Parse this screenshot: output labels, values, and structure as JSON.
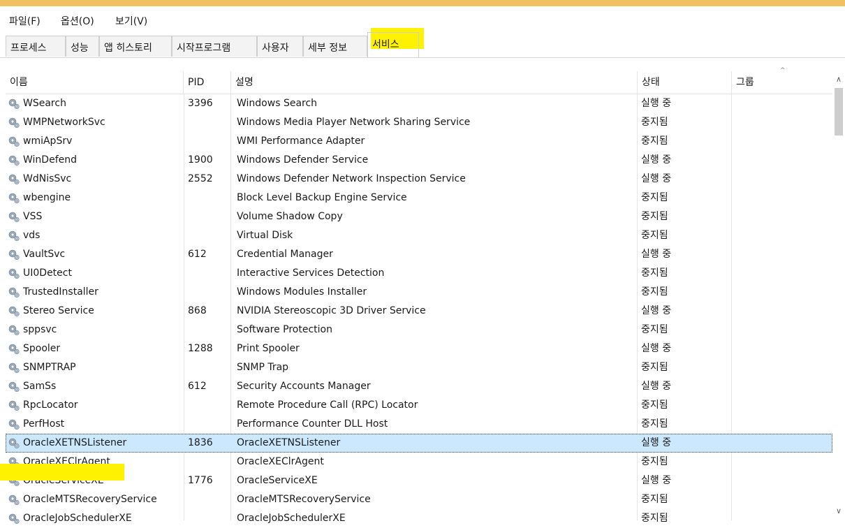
{
  "menu": [
    {
      "label": "파일(F)"
    },
    {
      "label": "옵션(O)"
    },
    {
      "label": "보기(V)"
    }
  ],
  "tabs": [
    {
      "label": "프로세스"
    },
    {
      "label": "성능"
    },
    {
      "label": "앱 히스토리"
    },
    {
      "label": "시작프로그램"
    },
    {
      "label": "사용자"
    },
    {
      "label": "세부 정보"
    },
    {
      "label": "서비스",
      "active": true
    }
  ],
  "columns": {
    "name": "이름",
    "pid": "PID",
    "desc": "설명",
    "status": "상태",
    "group": "그룹"
  },
  "sort_indicator": "^",
  "rows": [
    {
      "name": "WSearch",
      "pid": "3396",
      "desc": "Windows Search",
      "status": "실행 중"
    },
    {
      "name": "WMPNetworkSvc",
      "pid": "",
      "desc": "Windows Media Player Network Sharing Service",
      "status": "중지됨"
    },
    {
      "name": "wmiApSrv",
      "pid": "",
      "desc": "WMI Performance Adapter",
      "status": "중지됨"
    },
    {
      "name": "WinDefend",
      "pid": "1900",
      "desc": "Windows Defender Service",
      "status": "실행 중"
    },
    {
      "name": "WdNisSvc",
      "pid": "2552",
      "desc": "Windows Defender Network Inspection Service",
      "status": "실행 중"
    },
    {
      "name": "wbengine",
      "pid": "",
      "desc": "Block Level Backup Engine Service",
      "status": "중지됨"
    },
    {
      "name": "VSS",
      "pid": "",
      "desc": "Volume Shadow Copy",
      "status": "중지됨"
    },
    {
      "name": "vds",
      "pid": "",
      "desc": "Virtual Disk",
      "status": "중지됨"
    },
    {
      "name": "VaultSvc",
      "pid": "612",
      "desc": "Credential Manager",
      "status": "실행 중"
    },
    {
      "name": "UI0Detect",
      "pid": "",
      "desc": "Interactive Services Detection",
      "status": "중지됨"
    },
    {
      "name": "TrustedInstaller",
      "pid": "",
      "desc": "Windows Modules Installer",
      "status": "중지됨"
    },
    {
      "name": "Stereo Service",
      "pid": "868",
      "desc": "NVIDIA Stereoscopic 3D Driver Service",
      "status": "실행 중"
    },
    {
      "name": "sppsvc",
      "pid": "",
      "desc": "Software Protection",
      "status": "중지됨"
    },
    {
      "name": "Spooler",
      "pid": "1288",
      "desc": "Print Spooler",
      "status": "실행 중"
    },
    {
      "name": "SNMPTRAP",
      "pid": "",
      "desc": "SNMP Trap",
      "status": "중지됨"
    },
    {
      "name": "SamSs",
      "pid": "612",
      "desc": "Security Accounts Manager",
      "status": "실행 중"
    },
    {
      "name": "RpcLocator",
      "pid": "",
      "desc": "Remote Procedure Call (RPC) Locator",
      "status": "중지됨"
    },
    {
      "name": "PerfHost",
      "pid": "",
      "desc": "Performance Counter DLL Host",
      "status": "중지됨"
    },
    {
      "name": "OracleXETNSListener",
      "pid": "1836",
      "desc": "OracleXETNSListener",
      "status": "실행 중",
      "selected": true
    },
    {
      "name": "OracleXEClrAgent",
      "pid": "",
      "desc": "OracleXEClrAgent",
      "status": "중지됨"
    },
    {
      "name": "OracleServiceXE",
      "pid": "1776",
      "desc": "OracleServiceXE",
      "status": "실행 중"
    },
    {
      "name": "OracleMTSRecoveryService",
      "pid": "",
      "desc": "OracleMTSRecoveryService",
      "status": "중지됨"
    },
    {
      "name": "OracleJobSchedulerXE",
      "pid": "",
      "desc": "OracleJobSchedulerXE",
      "status": "중지됨"
    }
  ],
  "colors": {
    "selected_row": "#cce8ff",
    "highlight": "#fff200",
    "titlebar": "#f1c063"
  }
}
